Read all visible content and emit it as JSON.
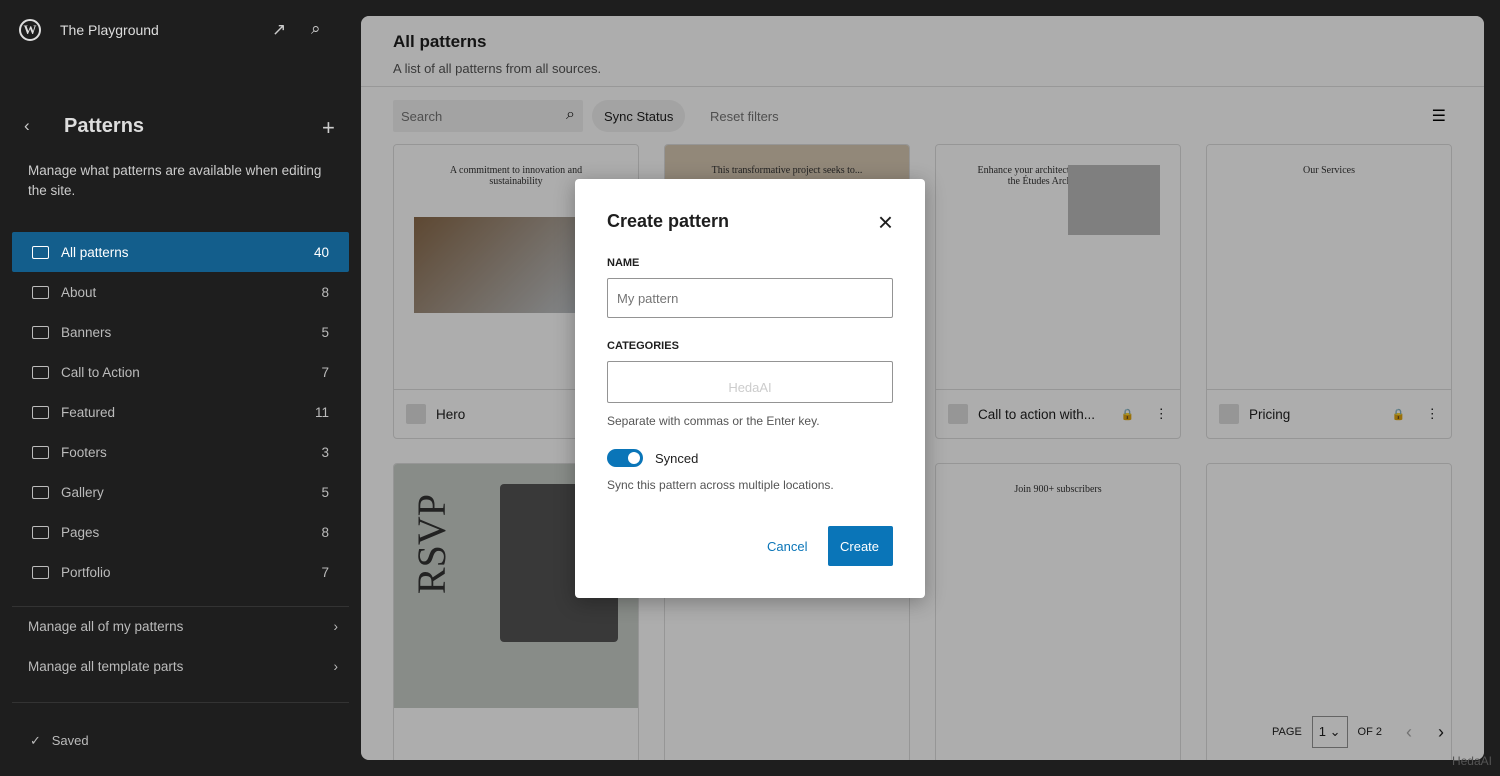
{
  "sidebar": {
    "site_title": "The Playground",
    "title": "Patterns",
    "description": "Manage what patterns are available when editing the site.",
    "items": [
      {
        "label": "All patterns",
        "count": "40"
      },
      {
        "label": "About",
        "count": "8"
      },
      {
        "label": "Banners",
        "count": "5"
      },
      {
        "label": "Call to Action",
        "count": "7"
      },
      {
        "label": "Featured",
        "count": "11"
      },
      {
        "label": "Footers",
        "count": "3"
      },
      {
        "label": "Gallery",
        "count": "5"
      },
      {
        "label": "Pages",
        "count": "8"
      },
      {
        "label": "Portfolio",
        "count": "7"
      }
    ],
    "manage_patterns": "Manage all of my patterns",
    "manage_parts": "Manage all template parts",
    "status": "Saved"
  },
  "main": {
    "title": "All patterns",
    "subtitle": "A list of all patterns from all sources.",
    "search_placeholder": "Search",
    "sync_status": "Sync Status",
    "reset_filters": "Reset filters",
    "cards": [
      {
        "name": "Hero",
        "preview": "A commitment to innovation and sustainability"
      },
      {
        "name": "",
        "preview": "This transformative project seeks to..."
      },
      {
        "name": "Call to action with...",
        "preview": "Enhance your architectural journey with the Études Architect app.",
        "locked": true
      },
      {
        "name": "Pricing",
        "preview": "Our Services",
        "locked": true
      },
      {
        "name": "",
        "preview": "RSVP"
      },
      {
        "name": "",
        "preview": ""
      },
      {
        "name": "",
        "preview": "Join 900+ subscribers"
      },
      {
        "name": "",
        "preview": ""
      }
    ],
    "pagination": {
      "page_label": "PAGE",
      "page": "1",
      "of_label": "OF 2"
    }
  },
  "modal": {
    "title": "Create pattern",
    "name_label": "NAME",
    "name_placeholder": "My pattern",
    "categories_label": "CATEGORIES",
    "categories_value": "HedaAI",
    "categories_help": "Separate with commas or the Enter key.",
    "synced_label": "Synced",
    "synced": true,
    "synced_help": "Sync this pattern across multiple locations.",
    "cancel": "Cancel",
    "create": "Create"
  },
  "watermark": "HedaAI",
  "colors": {
    "accent": "#0a75b8",
    "sidebar_active": "#135e8c"
  }
}
